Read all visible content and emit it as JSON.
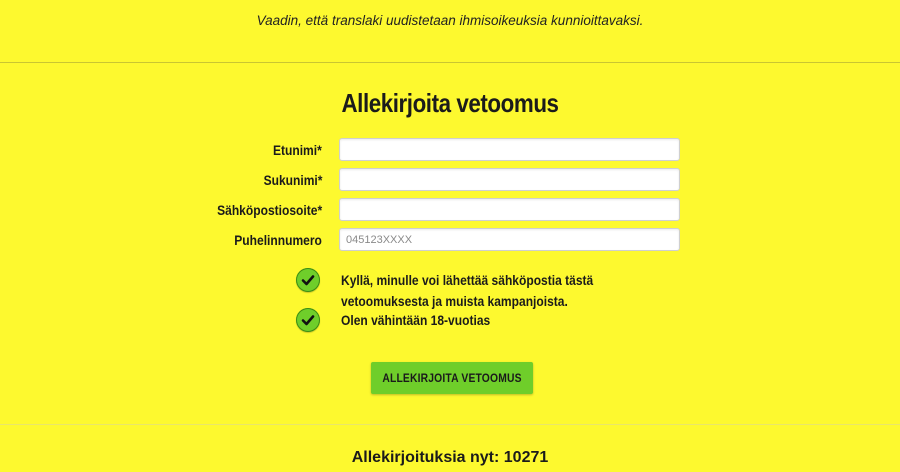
{
  "intro": {
    "text": "Vaadin, että translaki uudistetaan ihmisoikeuksia kunnioittavaksi."
  },
  "form": {
    "title": "Allekirjoita vetoomus",
    "fields": [
      {
        "label": "Etunimi*",
        "value": "",
        "placeholder": ""
      },
      {
        "label": "Sukunimi*",
        "value": "",
        "placeholder": ""
      },
      {
        "label": "Sähköpostiosoite*",
        "value": "",
        "placeholder": ""
      },
      {
        "label": "Puhelinnumero",
        "value": "",
        "placeholder": "045123XXXX"
      }
    ],
    "checkboxes": [
      {
        "label": "Kyllä, minulle voi lähettää sähköpostia tästä vetoomuksesta ja muista kampanjoista.",
        "checked": true
      },
      {
        "label": "Olen vähintään 18-vuotias",
        "checked": true
      }
    ],
    "submit_label": "ALLEKIRJOITA VETOOMUS"
  },
  "counter": {
    "text": "Allekirjoituksia nyt: 10271"
  },
  "colors": {
    "background": "#fdf92f",
    "accent_green": "#6fce2a",
    "text": "#1b1b1b"
  },
  "icons": {
    "checkbox": "check-circle-icon"
  }
}
